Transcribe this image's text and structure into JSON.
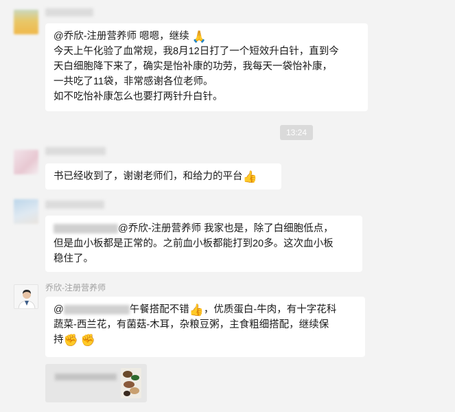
{
  "msg1": {
    "lines": [
      "@乔欣-注册营养师 嗯嗯，继续",
      "今天上午化验了血常规，我8月12日打了一个短效升白针，直到今",
      "天白细胞降下来了，确实是怡补康的功劳，我每天一袋怡补康，",
      "一共吃了11袋，非常感谢各位老师。",
      "如不吃怡补康怎么也要打两针升白针。"
    ],
    "emoji": "🙏"
  },
  "timestamp": "13:24",
  "msg2": {
    "text": "书已经收到了，谢谢老师们，和给力的平台",
    "emoji": "👍"
  },
  "msg3": {
    "line1": "@乔欣-注册营养师  我家也是，除了白细胞低点，",
    "line2": "但是血小板都是正常的。之前血小板都能打到20多。这次血小板",
    "line3": "稳住了。"
  },
  "msg4": {
    "sender": "乔欣-注册营养师",
    "prefix": "@",
    "line1_a": "午餐搭配不错",
    "line1_b": "，优质蛋白-牛肉，有十字花科",
    "line2": "蔬菜-西兰花，有菌菇-木耳，杂粮豆粥，主食粗细搭配，继续保",
    "line3": "持",
    "emoji_thumb": "👍",
    "emoji_fist": "✊"
  },
  "icons": {
    "pray": "praying-hands-icon",
    "thumb": "thumbs-up-icon",
    "fist": "raised-fist-icon"
  },
  "colors": {
    "background": "#f3f3f3",
    "bubble": "#ffffff",
    "time_badge": "#dadada"
  }
}
